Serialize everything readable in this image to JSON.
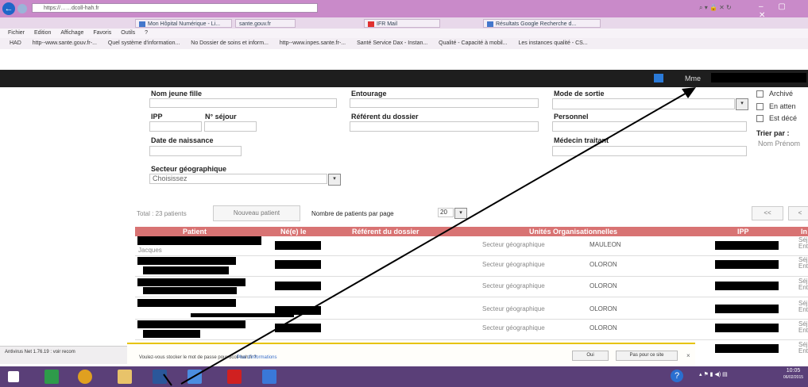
{
  "browser": {
    "address": "https://……dcoll-hah.fr",
    "tabs": [
      {
        "label": "Mon Hôpital Numérique - Li..."
      },
      {
        "label": "sante.gouv.fr"
      },
      {
        "label": "IFR Mail"
      },
      {
        "label": "Résultats Google Recherche d..."
      }
    ],
    "menu": [
      "Fichier",
      "Edition",
      "Affichage",
      "Favoris",
      "Outils",
      "?"
    ],
    "favorites": [
      "HAD",
      "http--www.sante.gouv.fr-...",
      "Quel système d'information...",
      "No Dossier de soins et inform...",
      "http--www.inpes.sante.fr-...",
      "Santé Service Dax - Instan...",
      "Qualité - Capacité à mobil...",
      "Les instances qualité - CS..."
    ],
    "window_controls": "– ▢ ✕",
    "nav_back": "←"
  },
  "app": {
    "user_label": "Mme"
  },
  "form": {
    "nom_jeune_fille": "Nom jeune fille",
    "entourage": "Entourage",
    "mode_de_sortie": "Mode de sortie",
    "ipp": "IPP",
    "n_sejour": "N° séjour",
    "referent": "Référent du dossier",
    "personnel": "Personnel",
    "date_naissance": "Date de naissance",
    "medecin": "Médecin traitant",
    "secteur": "Secteur géographique",
    "secteur_value": "Choisissez",
    "archive": "Archivé",
    "en_attente": "En atten",
    "est_decede": "Est décé",
    "trier_par": "Trier par :",
    "trier_value": "Nom Prénom",
    "dropdown_glyph": "▾"
  },
  "list": {
    "total": "Total : 23 patients",
    "new_patient": "Nouveau patient",
    "per_page_label": "Nombre de patients par page",
    "per_page_value": "20",
    "pager_first": "<<",
    "pager_prev": "<",
    "headers": [
      "Patient",
      "Né(e) le",
      "Référent du dossier",
      "Unités Organisationnelles",
      "IPP",
      "In"
    ],
    "rows": [
      {
        "patient": "Jacques",
        "unit_type": "Secteur géographique",
        "unit": "MAULEON",
        "info": "Séjo Entré"
      },
      {
        "patient": "",
        "unit_type": "Secteur géographique",
        "unit": "OLORON",
        "info": "Séjo Entré"
      },
      {
        "patient": "",
        "unit_type": "Secteur géographique",
        "unit": "OLORON",
        "info": "Séjo Entré"
      },
      {
        "patient": "",
        "unit_type": "Secteur géographique",
        "unit": "OLORON",
        "info": "Séjo Entré"
      },
      {
        "patient": "",
        "unit_type": "Secteur géographique",
        "unit": "OLORON",
        "info": "Séjo Entré"
      },
      {
        "patient": "",
        "unit_type": "",
        "unit": "",
        "info": "Séjo Entré"
      }
    ]
  },
  "notification": {
    "text": "Voulez-vous stocker le mot de passe pour dcoll-hah.fr ?",
    "link": "Plus d'informations",
    "yes": "Oui",
    "no": "Pas pour ce site",
    "close": "×"
  },
  "status": {
    "text": "Antivirus Net 1.76.19 : voir recom"
  },
  "taskbar": {
    "help": "?",
    "tray_time": "10:05",
    "tray_date": "06/02/2015"
  },
  "colors": {
    "table_header": "#d87373",
    "titlebar": "#c98ac9",
    "taskbar": "#5a3f78",
    "appbar": "#1e1e1e",
    "notification_border": "#e6c300"
  }
}
